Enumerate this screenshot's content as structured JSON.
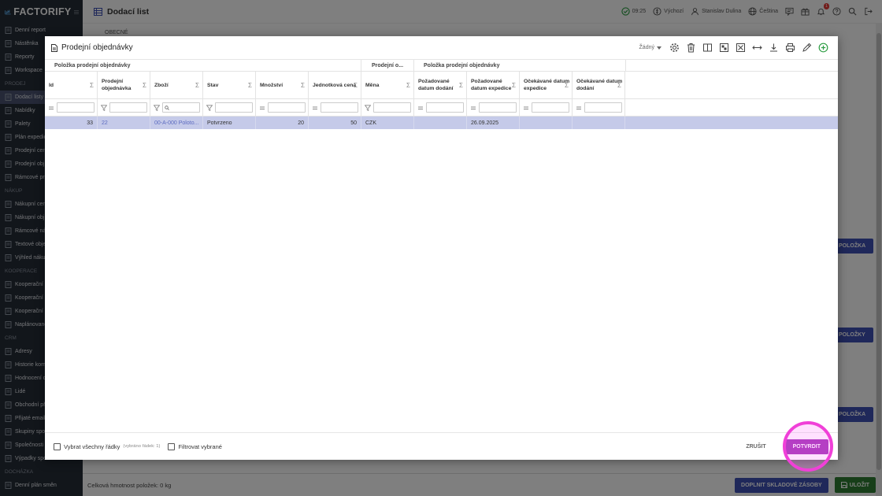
{
  "brand": "FACTORIFY",
  "sidebar": {
    "items": [
      {
        "type": "item",
        "label": "Denní report"
      },
      {
        "type": "item",
        "label": "Nástěnka"
      },
      {
        "type": "item",
        "label": "Reporty"
      },
      {
        "type": "item",
        "label": "Workspace"
      },
      {
        "type": "group",
        "label": "PRODEJ"
      },
      {
        "type": "item",
        "label": "Dodací listy",
        "active": true
      },
      {
        "type": "item",
        "label": "Nabídky"
      },
      {
        "type": "item",
        "label": "Palety"
      },
      {
        "type": "item",
        "label": "Plán expedic"
      },
      {
        "type": "item",
        "label": "Prodejní cen"
      },
      {
        "type": "item",
        "label": "Prodejní obj"
      },
      {
        "type": "item",
        "label": "Rámcové pro"
      },
      {
        "type": "group",
        "label": "NÁKUP"
      },
      {
        "type": "item",
        "label": "Nákupní cen"
      },
      {
        "type": "item",
        "label": "Nákupní obj"
      },
      {
        "type": "item",
        "label": "Rámcové ná"
      },
      {
        "type": "item",
        "label": "Textové obje"
      },
      {
        "type": "item",
        "label": "Výhled náku"
      },
      {
        "type": "group",
        "label": "KOOPERACE"
      },
      {
        "type": "item",
        "label": "Kooperační c"
      },
      {
        "type": "item",
        "label": "Kooperační c"
      },
      {
        "type": "item",
        "label": "Kooperační z"
      },
      {
        "type": "item",
        "label": "Naplánované"
      },
      {
        "type": "group",
        "label": "CRM"
      },
      {
        "type": "item",
        "label": "Adresy"
      },
      {
        "type": "item",
        "label": "Historie kom"
      },
      {
        "type": "item",
        "label": "Hodnocení d"
      },
      {
        "type": "item",
        "label": "Lidé"
      },
      {
        "type": "item",
        "label": "Obchodní pří"
      },
      {
        "type": "item",
        "label": "Přijaté emaily"
      },
      {
        "type": "item",
        "label": "Skupiny spol"
      },
      {
        "type": "item",
        "label": "Společnosti"
      },
      {
        "type": "item",
        "label": "Výpadky společnosti"
      },
      {
        "type": "group",
        "label": "DOCHÁZKA"
      },
      {
        "type": "item",
        "label": "Denní plán směn"
      }
    ]
  },
  "topbar": {
    "page_title": "Dodací list",
    "time": "09:25",
    "profile": "Výchozí",
    "user": "Stanislav Dulina",
    "language": "Čeština",
    "notif_count": "1"
  },
  "background": {
    "tab_label": "OBECNÉ",
    "add_item_label": "POLOŽKA",
    "add_item_label2": "POLOŽKY",
    "total_weight": "Celková hmotnost položek: 0 kg",
    "fill_stock_label": "DOPLNIT SKLADOVÉ ZÁSOBY",
    "save_label": "ULOŽIT"
  },
  "dialog": {
    "title": "Prodejní objednávky",
    "view_select": "Žádný",
    "groups": [
      "Položka prodejní objednávky",
      "Prodejní o...",
      "Položka prodejní objednávky"
    ],
    "columns": [
      "Id",
      "Prodejní objednávka",
      "Zboží",
      "Stav",
      "Množství",
      "Jednotková cena",
      "Měna",
      "Požadované datum dodání",
      "Požadované datum expedice",
      "Očekávané datum expedice",
      "Očekávané datum dodání"
    ],
    "rows": [
      {
        "id": "33",
        "order": "22",
        "goods": "00-A-000 Poloto...",
        "state": "Potvrzeno",
        "qty": "20",
        "price": "50",
        "currency": "CZK",
        "req_delivery": "",
        "req_dispatch": "26.09.2025",
        "exp_dispatch": "",
        "exp_delivery": ""
      }
    ],
    "select_all_label": "Vybrat všechny řádky",
    "selected_info": "(vybráno řádek: 1)",
    "filter_selected_label": "Filtrovat vybrané",
    "cancel_label": "ZRUŠIT",
    "confirm_label": "POTVRDIT"
  },
  "colors": {
    "sidebar_bg": "#252c37",
    "accent": "#3f51b5",
    "selected_row": "#c5cae9",
    "confirm": "#9c27b0",
    "highlight_ring": "#f040d8"
  }
}
